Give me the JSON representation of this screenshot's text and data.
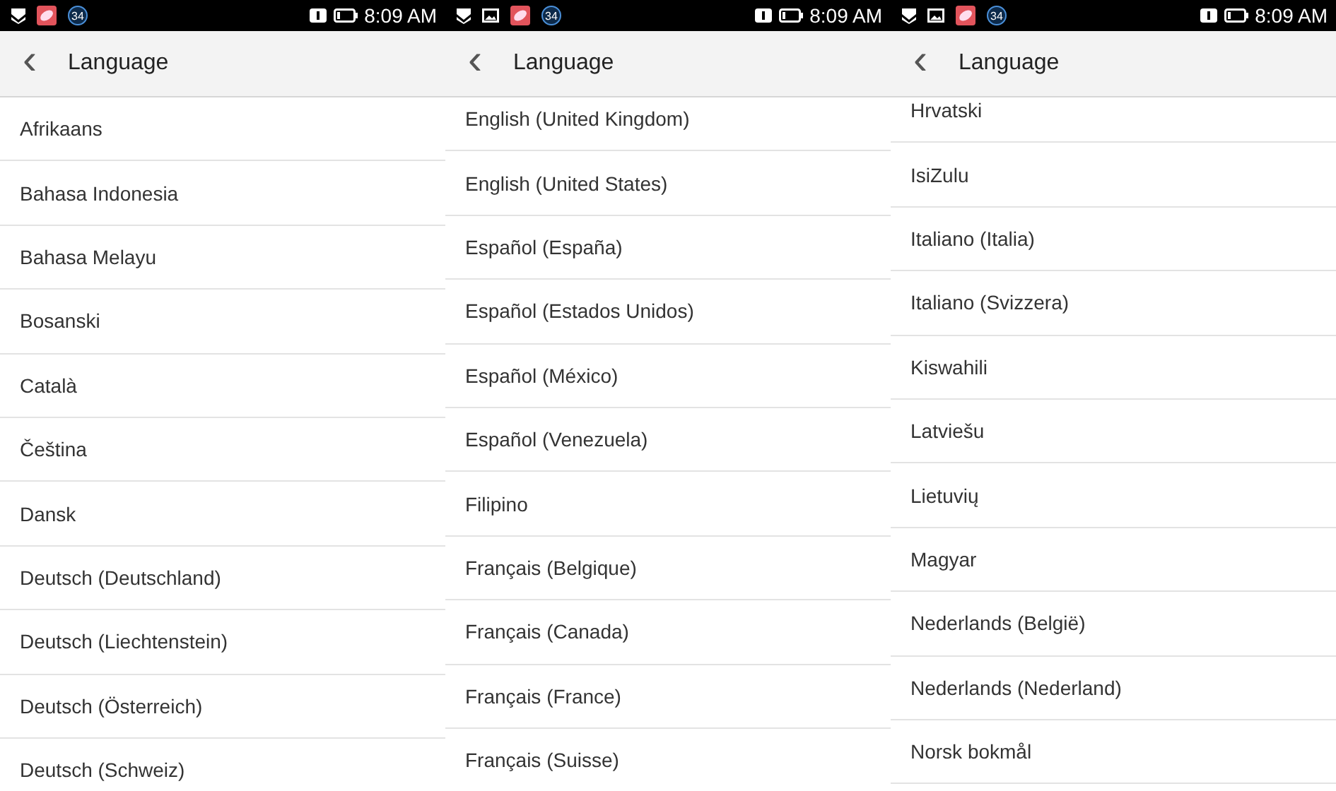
{
  "screens": [
    {
      "status_bar": {
        "notifications": [
          {
            "kind": "shield"
          },
          {
            "kind": "app"
          },
          {
            "kind": "badge",
            "text": "34"
          }
        ],
        "time": "8:09 AM"
      },
      "header": {
        "back": "‹",
        "title": "Language"
      },
      "languages": [
        "Afrikaans",
        "Bahasa Indonesia",
        "Bahasa Melayu",
        "Bosanski",
        "Català",
        "Čeština",
        "Dansk",
        "Deutsch (Deutschland)",
        "Deutsch (Liechtenstein)",
        "Deutsch (Österreich)",
        "Deutsch (Schweiz)"
      ]
    },
    {
      "status_bar": {
        "notifications": [
          {
            "kind": "shield"
          },
          {
            "kind": "picture"
          },
          {
            "kind": "app"
          },
          {
            "kind": "badge",
            "text": "34"
          }
        ],
        "time": "8:09 AM"
      },
      "header": {
        "back": "‹",
        "title": "Language"
      },
      "languages": [
        "English (United Kingdom)",
        "English (United States)",
        "Español (España)",
        "Español (Estados Unidos)",
        "Español (México)",
        "Español (Venezuela)",
        "Filipino",
        "Français (Belgique)",
        "Français (Canada)",
        "Français (France)",
        "Français (Suisse)"
      ]
    },
    {
      "status_bar": {
        "notifications": [
          {
            "kind": "shield"
          },
          {
            "kind": "picture"
          },
          {
            "kind": "app"
          },
          {
            "kind": "badge",
            "text": "34"
          }
        ],
        "time": "8:09 AM"
      },
      "header": {
        "back": "‹",
        "title": "Language"
      },
      "languages": [
        "Hrvatski",
        "IsiZulu",
        "Italiano (Italia)",
        "Italiano (Svizzera)",
        "Kiswahili",
        "Latviešu",
        "Lietuvių",
        "Magyar",
        "Nederlands (België)",
        "Nederlands (Nederland)",
        "Norsk bokmål"
      ]
    }
  ]
}
